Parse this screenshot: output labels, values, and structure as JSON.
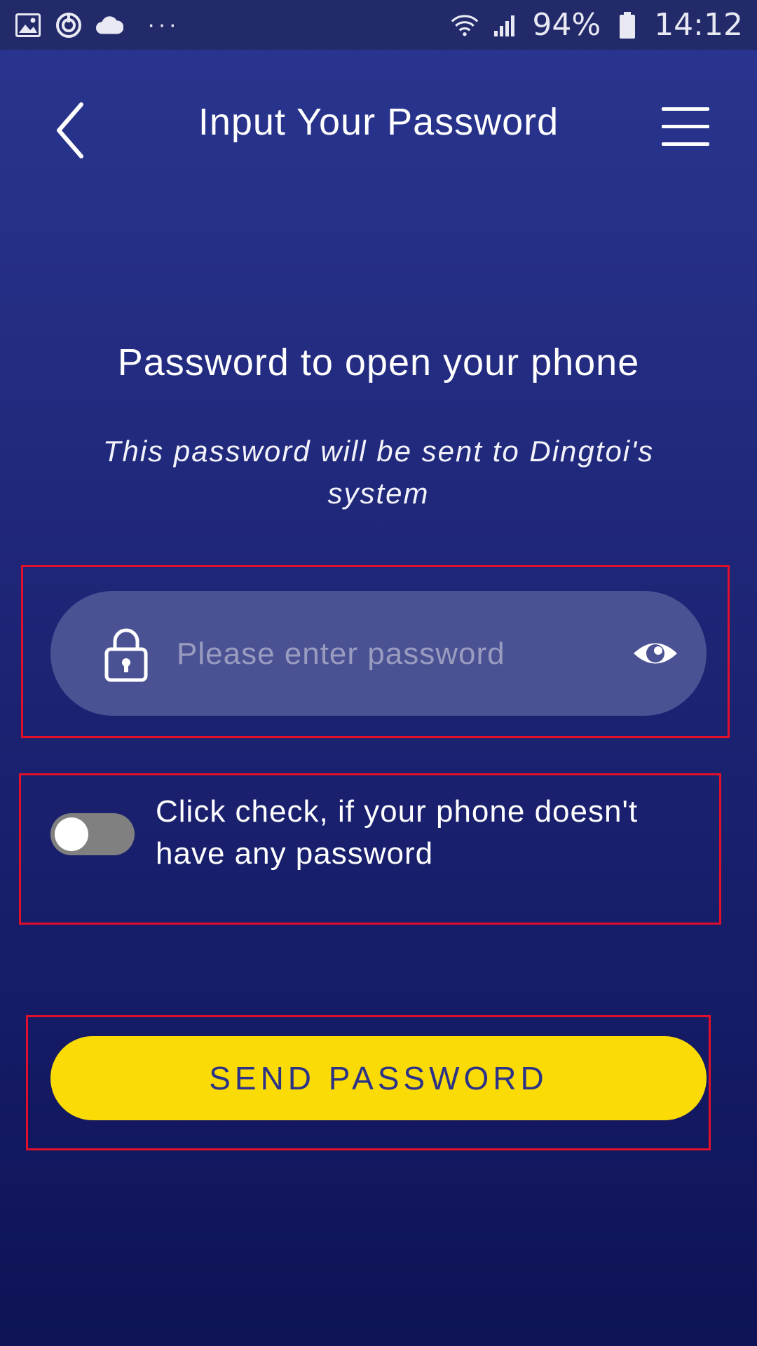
{
  "status_bar": {
    "battery": "94%",
    "time": "14:12",
    "icons": [
      "gallery-icon",
      "sync-icon",
      "cloud-icon",
      "more-notifications-icon",
      "wifi-icon",
      "signal-icon",
      "battery-icon"
    ]
  },
  "header": {
    "title": "Input Your Password",
    "back_icon": "chevron-left-icon",
    "menu_icon": "hamburger-menu-icon"
  },
  "main": {
    "heading": "Password to open your phone",
    "subheading": "This password will be sent to Dingtoi's system",
    "password_field": {
      "placeholder": "Please enter password",
      "value": "",
      "lock_icon": "lock-icon",
      "visibility_icon": "eye-icon"
    },
    "no_password_toggle": {
      "checked": false,
      "label": "Click check, if your phone doesn't have any password"
    },
    "send_button": {
      "label": "SEND PASSWORD"
    }
  },
  "colors": {
    "background_top": "#2a3690",
    "background_bottom": "#0e1357",
    "field_bg": "#4a5294",
    "button_bg": "#fbdb05",
    "button_text": "#2b3388",
    "highlight_border": "#e0102a",
    "toggle_off": "#808080"
  }
}
